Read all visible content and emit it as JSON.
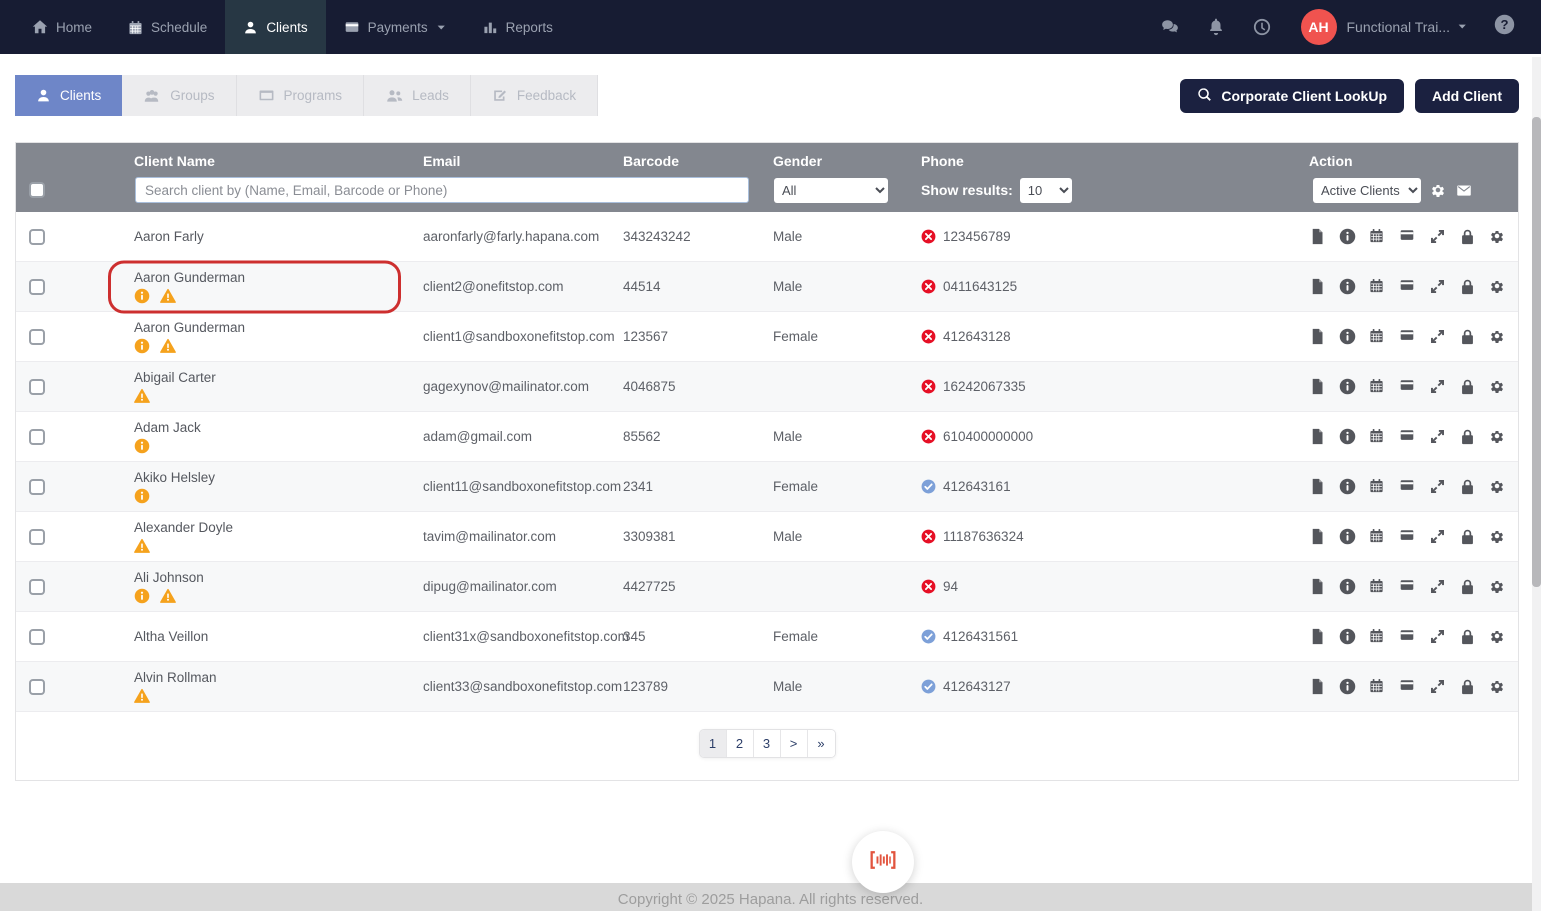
{
  "navbar": {
    "items": [
      {
        "label": "Home",
        "icon": "home",
        "active": false
      },
      {
        "label": "Schedule",
        "icon": "calendar",
        "active": false
      },
      {
        "label": "Clients",
        "icon": "person",
        "active": true
      },
      {
        "label": "Payments",
        "icon": "payment-card",
        "active": false,
        "has_caret": true
      },
      {
        "label": "Reports",
        "icon": "bar-chart",
        "active": false
      }
    ],
    "right_icons": [
      "chat",
      "bell",
      "clock"
    ],
    "user": {
      "initials": "AH",
      "name": "Functional Trai...",
      "avatar_color": "#f0534f"
    },
    "help_icon": "question-circle"
  },
  "tabs": [
    {
      "label": "Clients",
      "icon": "person",
      "active": true
    },
    {
      "label": "Groups",
      "icon": "people-group",
      "active": false
    },
    {
      "label": "Programs",
      "icon": "program-card",
      "active": false
    },
    {
      "label": "Leads",
      "icon": "leads-people",
      "active": false
    },
    {
      "label": "Feedback",
      "icon": "feedback-pen",
      "active": false
    }
  ],
  "toolbar": {
    "corporate_lookup_label": "Corporate Client LookUp",
    "add_client_label": "Add Client"
  },
  "table": {
    "columns": [
      "Client Name",
      "Email",
      "Barcode",
      "Gender",
      "Phone",
      "Action"
    ],
    "search_placeholder": "Search client by (Name, Email, Barcode or Phone)",
    "gender_filter_value": "All",
    "show_results_label": "Show results:",
    "show_results_value": "10",
    "status_filter_value": "Active Clients",
    "row_action_icons": [
      "document",
      "info-circle",
      "calendar",
      "payment-card",
      "expand",
      "lock",
      "gear"
    ],
    "rows": [
      {
        "name": "Aaron Farly",
        "flags": [],
        "email": "aaronfarly@farly.hapana.com",
        "barcode": "343243242",
        "gender": "Male",
        "phone": "123456789",
        "phone_status": "invalid",
        "highlighted": false
      },
      {
        "name": "Aaron Gunderman",
        "flags": [
          "info",
          "warning"
        ],
        "email": "client2@onefitstop.com",
        "barcode": "44514",
        "gender": "Male",
        "phone": "0411643125",
        "phone_status": "invalid",
        "highlighted": true
      },
      {
        "name": "Aaron Gunderman",
        "flags": [
          "info",
          "warning"
        ],
        "email": "client1@sandboxonefitstop.com",
        "barcode": "123567",
        "gender": "Female",
        "phone": "412643128",
        "phone_status": "invalid",
        "highlighted": false
      },
      {
        "name": "Abigail Carter",
        "flags": [
          "warning"
        ],
        "email": "gagexynov@mailinator.com",
        "barcode": "4046875",
        "gender": "",
        "phone": "16242067335",
        "phone_status": "invalid",
        "highlighted": false
      },
      {
        "name": "Adam Jack",
        "flags": [
          "info"
        ],
        "email": "adam@gmail.com",
        "barcode": "85562",
        "gender": "Male",
        "phone": "610400000000",
        "phone_status": "invalid",
        "highlighted": false
      },
      {
        "name": "Akiko Helsley",
        "flags": [
          "info"
        ],
        "email": "client11@sandboxonefitstop.com",
        "barcode": "2341",
        "gender": "Female",
        "phone": "412643161",
        "phone_status": "valid",
        "highlighted": false
      },
      {
        "name": "Alexander Doyle",
        "flags": [
          "warning"
        ],
        "email": "tavim@mailinator.com",
        "barcode": "3309381",
        "gender": "Male",
        "phone": "11187636324",
        "phone_status": "invalid",
        "highlighted": false
      },
      {
        "name": "Ali Johnson",
        "flags": [
          "info",
          "warning"
        ],
        "email": "dipug@mailinator.com",
        "barcode": "4427725",
        "gender": "",
        "phone": "94",
        "phone_status": "invalid",
        "highlighted": false
      },
      {
        "name": "Altha Veillon",
        "flags": [],
        "email": "client31x@sandboxonefitstop.com",
        "barcode": "345",
        "gender": "Female",
        "phone": "4126431561",
        "phone_status": "valid",
        "highlighted": false
      },
      {
        "name": "Alvin Rollman",
        "flags": [
          "warning"
        ],
        "email": "client33@sandboxonefitstop.com",
        "barcode": "123789",
        "gender": "Male",
        "phone": "412643127",
        "phone_status": "valid",
        "highlighted": false
      }
    ]
  },
  "pagination": {
    "pages": [
      "1",
      "2",
      "3",
      ">",
      "»"
    ],
    "active": "1"
  },
  "fab": {
    "icon": "barcode-scan"
  },
  "footer": {
    "copyright": "Copyright © 2025 Hapana. All rights reserved."
  },
  "colors": {
    "navbar_bg": "#171c33",
    "active_nav_bg": "#273744",
    "active_tab": "#6e86c8",
    "dark_button": "#1b2140",
    "table_header": "#83878f",
    "invalid_red": "#e60f25",
    "valid_blue": "#7da0d8",
    "flag_orange": "#f5a21d",
    "highlight_ring": "#cd2f2f",
    "barcode_red": "#e2553f",
    "avatar_red": "#f0534f"
  }
}
